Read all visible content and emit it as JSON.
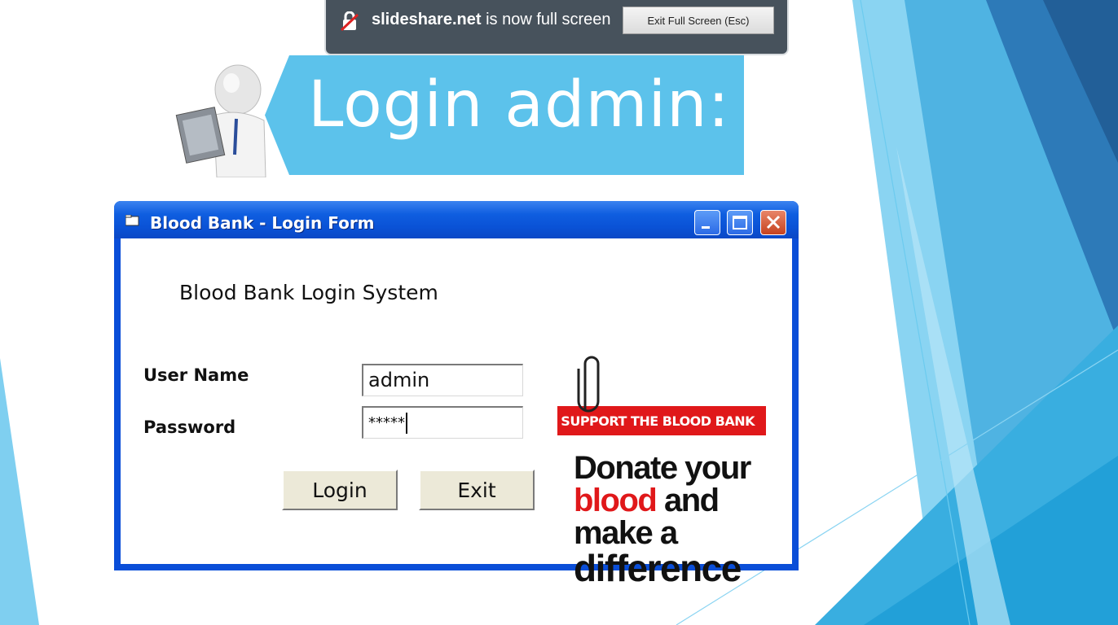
{
  "fullscreen_notice": {
    "site": "slideshare.net",
    "message": "is now full screen",
    "exit_button": "Exit Full Screen (Esc)"
  },
  "slide": {
    "title": "Login admin:",
    "theme_colors": {
      "banner": "#5cc2eb",
      "accent_dark": "#2d7ab8",
      "accent_light": "#8ad4f2"
    }
  },
  "window": {
    "title": "Blood Bank - Login Form",
    "controls": {
      "minimize": "minimize-icon",
      "maximize": "maximize-icon",
      "close": "close-icon"
    },
    "titlebar_color": "#0a52d6"
  },
  "form": {
    "heading": "Blood Bank Login System",
    "username_label": "User Name",
    "username_value": "admin",
    "password_label": "Password",
    "password_value": "*****",
    "login_button": "Login",
    "exit_button": "Exit"
  },
  "poster": {
    "ribbon": "SUPPORT THE BLOOD BANK",
    "line1": "Donate your",
    "line2_red": "blood",
    "line2_rest": " and",
    "line3": "make a",
    "line4": "difference",
    "red_color": "#e0181a"
  }
}
